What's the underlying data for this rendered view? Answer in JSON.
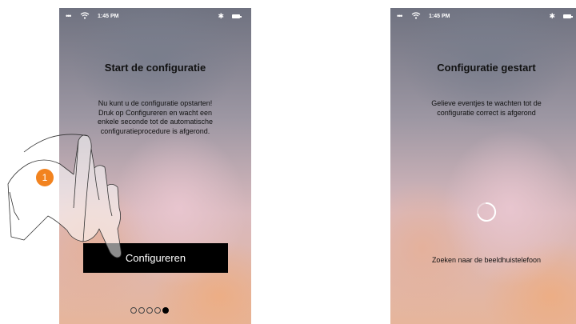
{
  "left_screen": {
    "status_bar": {
      "time": "1:45 PM"
    },
    "title": "Start de configuratie",
    "body_lines": [
      "Nu kunt u de configuratie opstarten!",
      "Druk op Configureren en wacht een",
      "enkele seconde tot de automatische",
      "configuratieprocedure is afgerond."
    ],
    "button_label": "Configureren",
    "pager": {
      "total": 5,
      "active_index": 4
    }
  },
  "right_screen": {
    "status_bar": {
      "time": "1:45 PM"
    },
    "title": "Configuratie gestart",
    "body_lines": [
      "Gelieve eventjes te wachten tot de",
      "configuratie correct is afgerond"
    ],
    "status_text": "Zoeken naar de beeldhuistelefoon"
  },
  "callout": {
    "number": "1",
    "color": "#f2831f"
  },
  "icons": [
    "signal-dots-icon",
    "wifi-icon",
    "bluetooth-icon",
    "battery-icon",
    "loading-spinner-icon",
    "pointing-hand-icon"
  ]
}
